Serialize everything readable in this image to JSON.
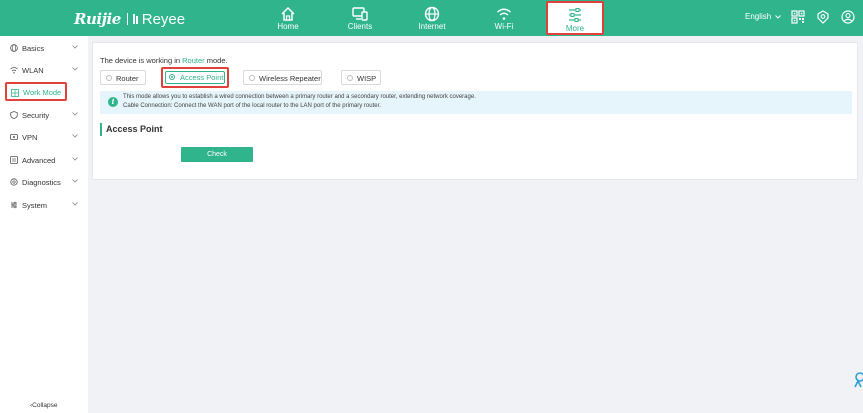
{
  "header": {
    "logo_brand": "Ruijie",
    "logo_sub": "Reyee",
    "nav": [
      {
        "id": "home",
        "label": "Home",
        "icon": "home-icon"
      },
      {
        "id": "clients",
        "label": "Clients",
        "icon": "clients-icon"
      },
      {
        "id": "internet",
        "label": "Internet",
        "icon": "globe-icon"
      },
      {
        "id": "wifi",
        "label": "Wi-Fi",
        "icon": "wifi-icon"
      },
      {
        "id": "more",
        "label": "More",
        "icon": "sliders-icon",
        "active": true
      }
    ],
    "language": "English",
    "icons": [
      "qr-code-icon",
      "help-icon",
      "user-icon"
    ]
  },
  "sidebar": {
    "items": [
      {
        "id": "basics",
        "label": "Basics",
        "icon": "globe-icon"
      },
      {
        "id": "wlan",
        "label": "WLAN",
        "icon": "wifi-icon"
      },
      {
        "id": "workmode",
        "label": "Work Mode",
        "icon": "workmode-icon",
        "active": true
      },
      {
        "id": "security",
        "label": "Security",
        "icon": "shield-icon"
      },
      {
        "id": "vpn",
        "label": "VPN",
        "icon": "vpn-icon"
      },
      {
        "id": "advanced",
        "label": "Advanced",
        "icon": "advanced-icon"
      },
      {
        "id": "diagnostics",
        "label": "Diagnostics",
        "icon": "diagnostics-icon"
      },
      {
        "id": "system",
        "label": "System",
        "icon": "system-icon"
      }
    ],
    "collapse_label": "Collapse"
  },
  "main": {
    "status_prefix": "The device is working in",
    "status_mode": "Router",
    "status_suffix": "mode.",
    "modes": [
      {
        "id": "router",
        "label": "Router",
        "selected": false
      },
      {
        "id": "ap",
        "label": "Access Point",
        "selected": true
      },
      {
        "id": "repeater",
        "label": "Wireless Repeater",
        "selected": false
      },
      {
        "id": "wisp",
        "label": "WISP",
        "selected": false
      }
    ],
    "info_line1": "This mode allows you to establish a wired connection between a primary router and a secondary router, extending network coverage.",
    "info_line2": "Cable Connection: Connect the WAN port of the local router to the LAN port of the primary router.",
    "section_title": "Access Point",
    "check_button": "Check"
  },
  "colors": {
    "accent": "#2fb48c",
    "highlight_border": "#e0413a",
    "info_bg": "#e6f4fb",
    "page_bg": "#f0f2f5"
  }
}
